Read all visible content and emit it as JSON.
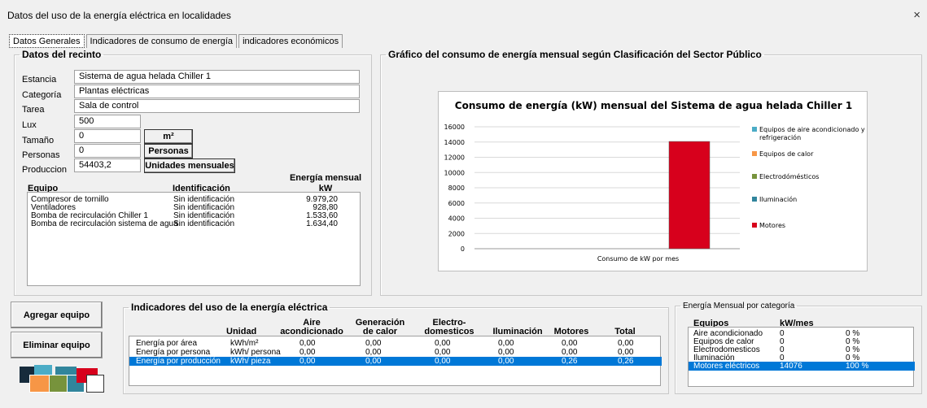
{
  "window": {
    "title": "Datos del uso de la energía eléctrica en localidades",
    "close": "×"
  },
  "tabs": [
    "Datos Generales",
    "Indicadores de consumo de energía",
    "indicadores económicos"
  ],
  "recinto": {
    "legend": "Datos del recinto",
    "fields": [
      {
        "label": "Estancia",
        "value": "Sistema de agua helada Chiller 1"
      },
      {
        "label": "Categoría",
        "value": "Plantas eléctricas"
      },
      {
        "label": "Tarea",
        "value": "Sala de control"
      },
      {
        "label": "Lux",
        "value": "500"
      },
      {
        "label": "Tamaño",
        "value": "0",
        "unit": "m²"
      },
      {
        "label": "Personas",
        "value": "0",
        "unit": "Personas"
      },
      {
        "label": "Produccion",
        "value": "54403,2",
        "unit": "Unidades mensuales"
      }
    ],
    "list_headers": {
      "equipo": "Equipo",
      "identificacion": "Identificación",
      "energia": "Energía mensual",
      "energia_unit": "kW"
    },
    "equipos": [
      {
        "name": "Compresor de tornillo",
        "id": "Sin identificación",
        "energia": "9.979,20"
      },
      {
        "name": "Ventiladores",
        "id": "Sin identificación",
        "energia": "928,80"
      },
      {
        "name": "Bomba de recirculación Chiller 1",
        "id": "Sin identificación",
        "energia": "1.533,60"
      },
      {
        "name": "Bomba de recirculación sistema de agua",
        "id": "Sin identificación",
        "energia": "1.634,40"
      }
    ]
  },
  "grafico": {
    "legend": "Gráfico del consumo de energía mensual según Clasificación del Sector  Público"
  },
  "chart_data": {
    "type": "bar",
    "title": "Consumo de energía (kW) mensual del Sistema de agua helada Chiller 1",
    "categories": [
      "Consumo de kW por mes"
    ],
    "series": [
      {
        "name": "Equipos de aire acondicionado y refrigeración",
        "values": [
          0
        ],
        "color": "#4bacc6"
      },
      {
        "name": "Equipos de calor",
        "values": [
          0
        ],
        "color": "#f79646"
      },
      {
        "name": "Electrodómésticos",
        "values": [
          0
        ],
        "color": "#77933c"
      },
      {
        "name": "Iluminación",
        "values": [
          0
        ],
        "color": "#31859c"
      },
      {
        "name": "Motores",
        "values": [
          14076
        ],
        "color": "#d7001c"
      }
    ],
    "ylim": [
      0,
      16000
    ],
    "yticks": [
      "0",
      "2000",
      "4000",
      "6000",
      "8000",
      "10000",
      "12000",
      "14000",
      "16000"
    ],
    "grid": true,
    "legend_position": "right"
  },
  "buttons": {
    "agregar": "Agregar equipo",
    "eliminar": "Eliminar equipo"
  },
  "indicadores": {
    "legend": "Indicadores del uso de la energía eléctrica",
    "headers": [
      "Unidad",
      "Aire acondicionado",
      "Generación de calor",
      "Electro-domesticos",
      "Iluminación",
      "Motores",
      "Total"
    ],
    "header_lines": [
      [
        "Unidad"
      ],
      [
        "Aire",
        "acondicionado"
      ],
      [
        "Generación",
        "de calor"
      ],
      [
        "Electro-",
        "domesticos"
      ],
      [
        "Iluminación"
      ],
      [
        "Motores"
      ],
      [
        "Total"
      ]
    ],
    "rows": [
      {
        "name": "Energía por área",
        "unit": "kWh/m²",
        "vals": [
          "0,00",
          "0,00",
          "0,00",
          "0,00",
          "0,00",
          "0,00"
        ]
      },
      {
        "name": "Energía por persona",
        "unit": "kWh/ persona",
        "vals": [
          "0,00",
          "0,00",
          "0,00",
          "0,00",
          "0,00",
          "0,00"
        ]
      },
      {
        "name": "Energía por producción",
        "unit": "kWh/ pieza",
        "vals": [
          "0,00",
          "0,00",
          "0,00",
          "0,00",
          "0,26",
          "0,26"
        ]
      }
    ]
  },
  "categoria": {
    "legend": "Energía Mensual por categoría",
    "headers": [
      "Equipos",
      "kW/mes"
    ],
    "rows": [
      {
        "name": "Aire acondicionado",
        "kw": "0",
        "pct": "0 %"
      },
      {
        "name": "Equipos de calor",
        "kw": "0",
        "pct": "0 %"
      },
      {
        "name": "Electrodomesticos",
        "kw": "0",
        "pct": "0 %"
      },
      {
        "name": "Iluminación",
        "kw": "0",
        "pct": "0 %"
      },
      {
        "name": "Motores eléctricos",
        "kw": "14076",
        "pct": "100 %"
      }
    ]
  },
  "colors": {
    "selection": "#0078d7",
    "motores": "#d7001c"
  }
}
